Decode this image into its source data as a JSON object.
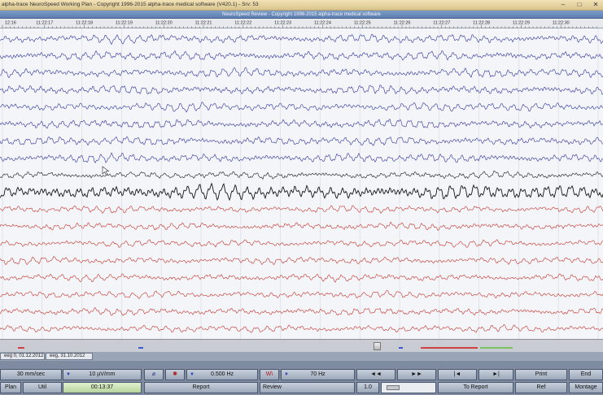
{
  "window": {
    "title": "alpha-trace NeuroSpeed Working Plan - Copyright 1996-2015 alpha-trace medical software (V420.1) - Srv: 53",
    "subtitle": "NeuroSpeed Review - Copyright 1996-2015 alpha-trace medical software",
    "minimize": "–",
    "maximize": "□",
    "close": "✕"
  },
  "time_axis": {
    "labels": [
      "12:16",
      "11:22:17",
      "11:22:18",
      "11:22:19",
      "11:22:20",
      "11:22:21",
      "11:22:22",
      "11:22:23",
      "11:22:24",
      "11:22:25",
      "11:22:26",
      "11:22:27",
      "11:22:28",
      "11:22:29",
      "11:22:30"
    ]
  },
  "traces": {
    "colors": {
      "blue": "#2b2f9c",
      "black": "#141414",
      "red": "#c4302a"
    },
    "groups": [
      "blue",
      "blue",
      "blue",
      "blue",
      "blue",
      "blue",
      "blue",
      "blue",
      "black",
      "black",
      "red",
      "red",
      "red",
      "red",
      "red",
      "red",
      "red",
      "red"
    ]
  },
  "tabs": [
    {
      "label": "eeg 0, 01.12.2012"
    },
    {
      "label": "eeg, 31.10.2012"
    }
  ],
  "controls": {
    "speed": "30 mm/sec",
    "sensitivity": "10 µV/mm",
    "low_filter": "0.500 Hz",
    "high_filter": "70 Hz",
    "rewind": "◄◄",
    "forward": "►►",
    "jump_start": "|◄",
    "jump_end": "►|",
    "print": "Print",
    "end": "End",
    "plan": "Plan",
    "util": "Util",
    "time": "00:13:37",
    "report": "Report",
    "review": "Review",
    "zoom": "1.0",
    "to_report": "To Report",
    "ref": "Ref",
    "montage": "Montage",
    "filter_icon": "W\\",
    "bw_icon": "⌀",
    "marker_icon": "✱"
  }
}
